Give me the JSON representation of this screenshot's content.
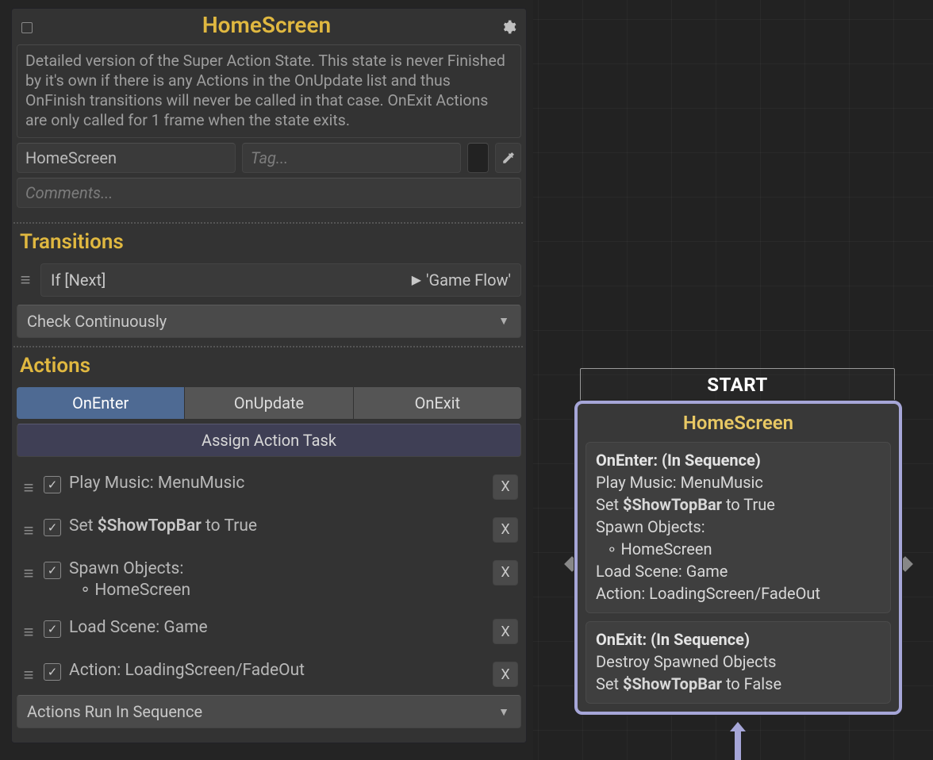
{
  "inspector": {
    "title": "HomeScreen",
    "description": "Detailed version of the Super Action State. This state is never Finished by it's own if there is any Actions in the OnUpdate list and thus OnFinish transitions will never be called in that case. OnExit Actions are only called for 1 frame when the state exits.",
    "name_value": "HomeScreen",
    "tag_placeholder": "Tag...",
    "comments_placeholder": "Comments..."
  },
  "transitions": {
    "heading": "Transitions",
    "condition": "If [Next]",
    "target": "'Game Flow'",
    "check_mode": "Check Continuously"
  },
  "actions": {
    "heading": "Actions",
    "tabs": {
      "on_enter": "OnEnter",
      "on_update": "OnUpdate",
      "on_exit": "OnExit"
    },
    "assign_label": "Assign Action Task",
    "list": [
      {
        "checked": true,
        "text": "Play Music: MenuMusic"
      },
      {
        "checked": true,
        "rich": {
          "pre": "Set ",
          "bold": "$ShowTopBar",
          "post": " to True"
        }
      },
      {
        "checked": true,
        "multi": {
          "head": "Spawn Objects:",
          "bullet": "HomeScreen"
        }
      },
      {
        "checked": true,
        "text": "Load Scene: Game"
      },
      {
        "checked": true,
        "text": "Action: LoadingScreen/FadeOut"
      }
    ],
    "run_mode": "Actions Run In Sequence",
    "delete_label": "X"
  },
  "graph": {
    "start_label": "START",
    "node_title": "HomeScreen",
    "on_enter": {
      "header": "OnEnter: (In Sequence)",
      "lines": [
        "Play Music: MenuMusic",
        {
          "pre": "Set ",
          "bold": "$ShowTopBar",
          "post": " to True"
        },
        "Spawn Objects:",
        {
          "bullet": "HomeScreen"
        },
        "Load Scene: Game",
        "Action: LoadingScreen/FadeOut"
      ]
    },
    "on_exit": {
      "header": "OnExit: (In Sequence)",
      "lines": [
        "Destroy Spawned Objects",
        {
          "pre": "Set ",
          "bold": "$ShowTopBar",
          "post": " to False"
        }
      ]
    }
  }
}
